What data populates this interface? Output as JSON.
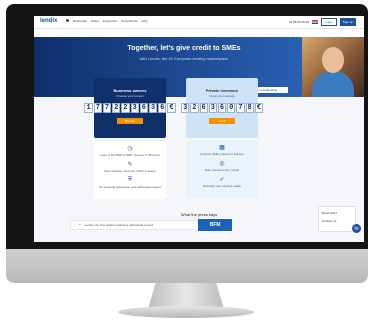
{
  "topbar": {
    "logo": "lendix",
    "nav": [
      "Entreprise",
      "Prêter",
      "Emprunter",
      "Comprendre",
      "FAQ"
    ],
    "phone": "01 85 08 49 30",
    "login": "Login",
    "signup": "Sign up"
  },
  "hero": {
    "title": "Together, let's give credit to SMEs",
    "subtitle": "with Lendix, the #1 European lending marketplace",
    "badge": "#1 in SME crowdlending"
  },
  "business": {
    "title": "Business owners",
    "subtitle": "Finance your project",
    "digits": [
      "1",
      "7",
      "7",
      "2",
      "2",
      "3",
      "6",
      "3",
      "6",
      "€"
    ],
    "button": "Borrow",
    "features": [
      {
        "icon": "clock-icon",
        "glyph": "◷",
        "text": "Loan of 50,000€ to 5M€ · Answer in 48 hours"
      },
      {
        "icon": "pen-icon",
        "glyph": "✎",
        "text": "Fast decision, and loan within 2 weeks"
      },
      {
        "icon": "shield-icon",
        "glyph": "⛨",
        "text": "No personal guarantee, and dedicated support"
      }
    ]
  },
  "lenders": {
    "title": "Private investors",
    "subtitle": "Invest your savings",
    "digits": [
      "3",
      "2",
      "6",
      "3",
      "6",
      "0",
      "7",
      "8",
      "€"
    ],
    "button": "Lend",
    "features": [
      {
        "icon": "building-icon",
        "glyph": "▦",
        "text": "Finance SME projects in Europe"
      },
      {
        "icon": "coins-icon",
        "glyph": "◎",
        "text": "Earn interest every month"
      },
      {
        "icon": "check-icon",
        "glyph": "✓",
        "text": "Diversify your savings easily"
      }
    ]
  },
  "press": {
    "heading": "What the press says",
    "quote": "Lendix, the first platform allowing individuals to lend",
    "logo": "BFM"
  },
  "chat": {
    "line1": "Need help?",
    "line2": "Contact us"
  }
}
